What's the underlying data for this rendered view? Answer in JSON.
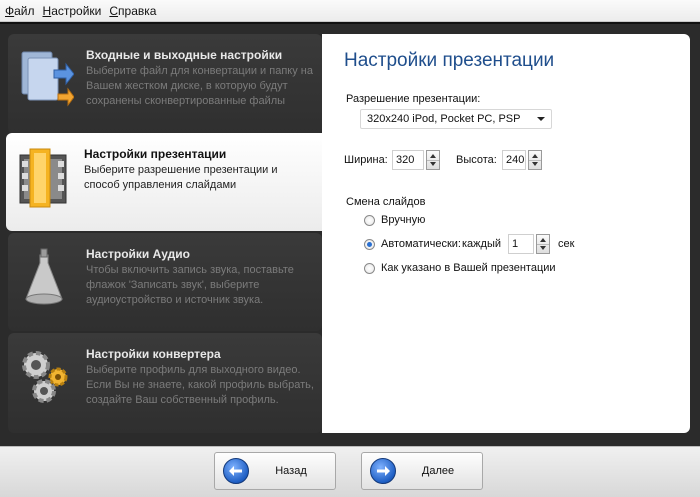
{
  "menu": [
    "Файл",
    "Настройки",
    "Справка"
  ],
  "sidebar": {
    "items": [
      {
        "title": "Входные и выходные настройки",
        "desc": "Выберите файл для конвертации и папку на Вашем жестком диске, в которую будут сохранены сконвертированные файлы",
        "icon": "files-icon",
        "active": false
      },
      {
        "title": "Настройки презентации",
        "desc": "Выберите разрешение презентации и способ управления слайдами",
        "icon": "slides-icon",
        "active": true
      },
      {
        "title": "Настройки Аудио",
        "desc": "Чтобы включить запись звука, поставьте флажок 'Записать звук', выберите аудиоустройство и источник звука.",
        "icon": "megaphone-icon",
        "active": false
      },
      {
        "title": "Настройки конвертера",
        "desc": "Выберите профиль для выходного видео. Если Вы не знаете, какой профиль выбрать, создайте Ваш собственный профиль.",
        "icon": "gears-icon",
        "active": false
      }
    ]
  },
  "panel": {
    "title": "Настройки презентации",
    "resolution_label": "Разрешение презентации:",
    "resolution_value": "320x240 iPod, Pocket PC, PSP",
    "width_label": "Ширина:",
    "width_value": "320",
    "height_label": "Высота:",
    "height_value": "240",
    "slide_change_label": "Смена слайдов",
    "options": {
      "manual": "Вручную",
      "auto": "Автоматически:",
      "every": "каждый",
      "interval_value": "1",
      "seconds": "сек",
      "as_presentation": "Как указано в Вашей презентации"
    },
    "selected_option": "auto"
  },
  "buttons": {
    "back": "Назад",
    "next": "Далее"
  },
  "colors": {
    "title_blue": "#1f4e8c",
    "accent_blue": "#1f5fc4"
  }
}
